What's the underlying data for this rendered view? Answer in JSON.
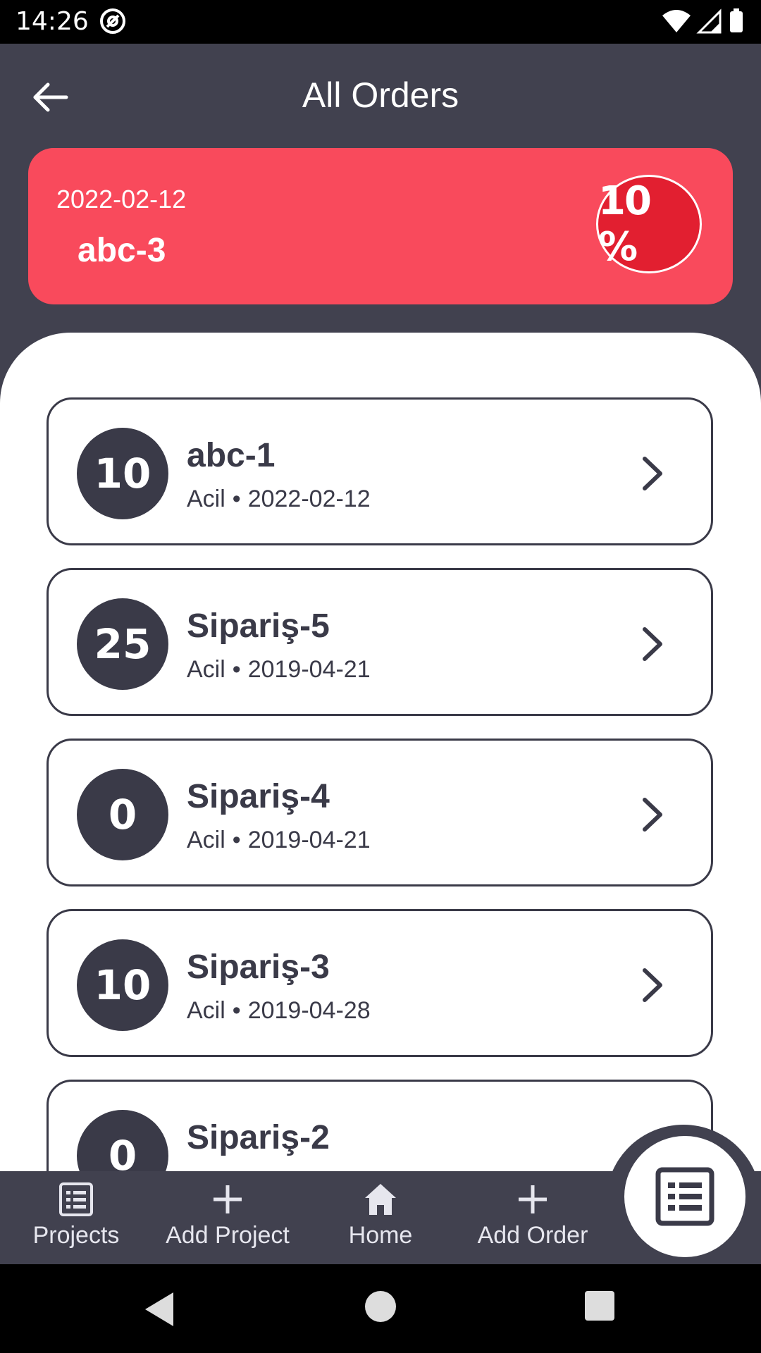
{
  "status_bar": {
    "time": "14:26"
  },
  "header": {
    "title": "All Orders"
  },
  "highlight": {
    "date": "2022-02-12",
    "name": "abc-3",
    "percent": "10 %"
  },
  "orders": [
    {
      "badge": "10",
      "name": "abc-1",
      "priority": "Acil",
      "date": "2022-02-12"
    },
    {
      "badge": "25",
      "name": "Sipariş-5",
      "priority": "Acil",
      "date": "2019-04-21"
    },
    {
      "badge": "0",
      "name": "Sipariş-4",
      "priority": "Acil",
      "date": "2019-04-21"
    },
    {
      "badge": "10",
      "name": "Sipariş-3",
      "priority": "Acil",
      "date": "2019-04-28"
    },
    {
      "badge": "0",
      "name": "Sipariş-2",
      "priority": "",
      "date": ""
    }
  ],
  "bottom_nav": {
    "projects": "Projects",
    "add_project": "Add Project",
    "home": "Home",
    "add_order": "Add Order"
  },
  "colors": {
    "background": "#41414f",
    "accent": "#f94a5c",
    "badge_red": "#e21f30",
    "dark": "#3a3a48"
  },
  "icons": {
    "back": "arrow-left-icon",
    "chevron": "chevron-right-icon",
    "projects": "list-icon",
    "add": "plus-icon",
    "home": "home-icon",
    "fab": "list-icon"
  }
}
